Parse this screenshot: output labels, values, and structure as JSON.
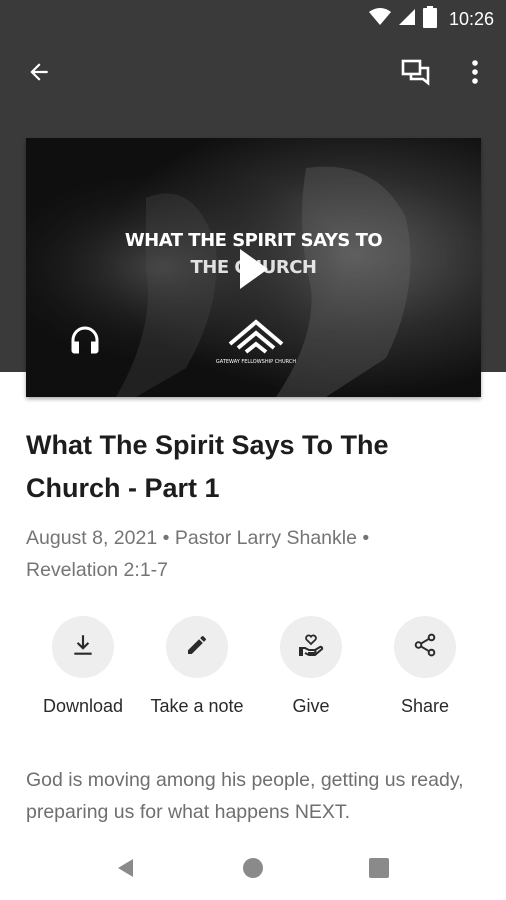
{
  "status_bar": {
    "time": "10:26"
  },
  "sermon": {
    "title": "What The Spirit Says To The Church - Part 1",
    "date": "August 8, 2021",
    "speaker": "Pastor Larry Shankle",
    "passage": "Revelation 2:1-7",
    "separator": "•",
    "artwork_title_line1": "WHAT THE SPIRIT SAYS TO",
    "artwork_title_line2": "THE CHURCH",
    "artwork_logo_text": "GATEWAY FELLOWSHIP CHURCH"
  },
  "actions": [
    {
      "label": "Download",
      "icon": "download-icon"
    },
    {
      "label": "Take a note",
      "icon": "pencil-icon"
    },
    {
      "label": "Give",
      "icon": "give-hand-heart-icon"
    },
    {
      "label": "Share",
      "icon": "share-icon"
    }
  ],
  "description": "God is moving among his people, getting us ready, preparing us for what happens NEXT.",
  "colors": {
    "header_bg": "#3a3a3a",
    "action_circle": "#eeeeee",
    "title_text": "#1d1d1d",
    "meta_text": "#757575"
  }
}
